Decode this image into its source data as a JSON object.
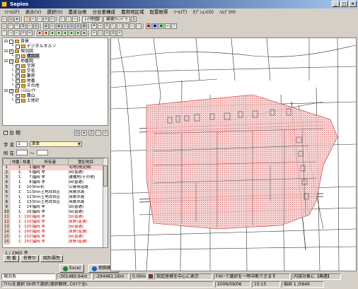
{
  "window": {
    "title": "Sepios"
  },
  "menu": [
    "ﾌｧｲﾙ(F)",
    "表示(V)",
    "選択(S)",
    "農家台帳",
    "分合筆構成",
    "農用地区域",
    "配置帳票",
    "ﾂｰﾙ(T)",
    "ｵﾌﾟｼｮﾝ(O)",
    "ﾍﾙﾌﾟ(H)"
  ],
  "toolbar": {
    "layer_label": "ﾚｲﾔ制御",
    "search_label": "検索ｳｨﾝﾄﾞｳ"
  },
  "tree": [
    {
      "label": "背景",
      "level": 0,
      "checked": false
    },
    {
      "label": "デジタルオルソ",
      "level": 1,
      "checked": false
    },
    {
      "label": "現況図",
      "level": 0,
      "checked": true
    },
    {
      "label": "構図図",
      "level": 1,
      "checked": true,
      "selected": true
    },
    {
      "label": "地番図",
      "level": 0,
      "checked": true
    },
    {
      "label": "字界",
      "level": 1,
      "checked": true
    },
    {
      "label": "字名",
      "level": 1,
      "checked": true
    },
    {
      "label": "筆界",
      "level": 1,
      "checked": true
    },
    {
      "label": "地番",
      "level": 1,
      "checked": true
    },
    {
      "label": "その他",
      "level": 1,
      "checked": true
    },
    {
      "label": "ｼｽﾃﾑﾚｲﾔ",
      "level": 0,
      "checked": true
    },
    {
      "label": "農山",
      "level": 1,
      "checked": true
    },
    {
      "label": "土地計",
      "level": 1,
      "checked": true
    }
  ],
  "panel": {
    "header_label": "台 帳",
    "aza_label": "字 名",
    "aza_value": "1",
    "aza_combo": "津本",
    "shozai_label": "所 在",
    "shozai_value": "～"
  },
  "table": {
    "headers": [
      "",
      "地番",
      "枝番",
      "所有者",
      "登記地目"
    ],
    "rows": [
      {
        "n": "1",
        "chiban": "1",
        "eda": "1",
        "owner": "福岡 孝",
        "chimoku": "宅地(現況畑)",
        "red": false
      },
      {
        "n": "2",
        "chiban": "1",
        "eda": "5",
        "owner": "福岡 孝",
        "chimoku": "田(普通)",
        "red": false
      },
      {
        "n": "3",
        "chiban": "1",
        "eda": "7",
        "owner": "福岡 孝",
        "chimoku": "雑種地(その他)",
        "red": false
      },
      {
        "n": "4",
        "chiban": "1",
        "eda": "8",
        "owner": "福岡 孝",
        "chimoku": "田(普通)",
        "red": false
      },
      {
        "n": "5",
        "chiban": "1",
        "eda": "10",
        "owner": "Shin町",
        "chimoku": "公衆用道路",
        "red": false
      },
      {
        "n": "6",
        "chiban": "1",
        "eda": "11",
        "owner": "Shin土地改良区",
        "chimoku": "用悪水路",
        "red": false
      },
      {
        "n": "7",
        "chiban": "1",
        "eda": "12",
        "owner": "Shin土地改良区",
        "chimoku": "用悪水路",
        "red": false
      },
      {
        "n": "8",
        "chiban": "1",
        "eda": "13",
        "owner": "Shin土地改良区",
        "chimoku": "用悪水路",
        "red": false
      },
      {
        "n": "9",
        "chiban": "1",
        "eda": "14",
        "owner": "福岡 孝",
        "chimoku": "田(普通)",
        "red": false
      },
      {
        "n": "10",
        "chiban": "1",
        "eda": "16",
        "owner": "福岡 孝",
        "chimoku": "田(普通)",
        "red": false
      },
      {
        "n": "11",
        "chiban": "1",
        "eda": "100",
        "owner": "福岡 孝",
        "chimoku": "田(普通)",
        "red": true
      },
      {
        "n": "12",
        "chiban": "1",
        "eda": "110",
        "owner": "福岡 孝",
        "chimoku": "原野(普通)",
        "red": true
      },
      {
        "n": "13",
        "chiban": "1",
        "eda": "120",
        "owner": "福岡 孝",
        "chimoku": "田(普通)",
        "red": true
      },
      {
        "n": "14",
        "chiban": "1",
        "eda": "200",
        "owner": "福岡 孝",
        "chimoku": "原野(普通)",
        "red": true
      },
      {
        "n": "15",
        "chiban": "1",
        "eda": "210",
        "owner": "福岡 孝",
        "chimoku": "田(普通)",
        "red": true
      },
      {
        "n": "16",
        "chiban": "1",
        "eda": "250",
        "owner": "福岡 孝",
        "chimoku": "原野(普通)",
        "red": true
      }
    ]
  },
  "record_count": "1 / 2965 件",
  "bottom": {
    "btn1": "地 番",
    "btn2": "名寄せ",
    "btn3": "図形属性",
    "excel": "Excel",
    "map_search": "地図検索"
  },
  "status": {
    "layer": "現況系",
    "coord_x": "-301480.64m",
    "coord_y": "-294461.16m",
    "scale": "0.00m",
    "center_label": "指定座標を中心に表示",
    "f4_hint": "F4ｷｰで選択を一時中断できます",
    "select_hint": "内容対象に【無題】",
    "hint": "ｱｲﾃﾑを選択 Shiftで選択/選択解除, Ctrlで全ﾚ",
    "date": "2006/09/06",
    "time": "15:15",
    "info": "福井 1 /5646"
  },
  "colors": {
    "hatch": "#f2b8b8",
    "hatch_line": "#d03030",
    "titlebar": "#0a246a"
  }
}
